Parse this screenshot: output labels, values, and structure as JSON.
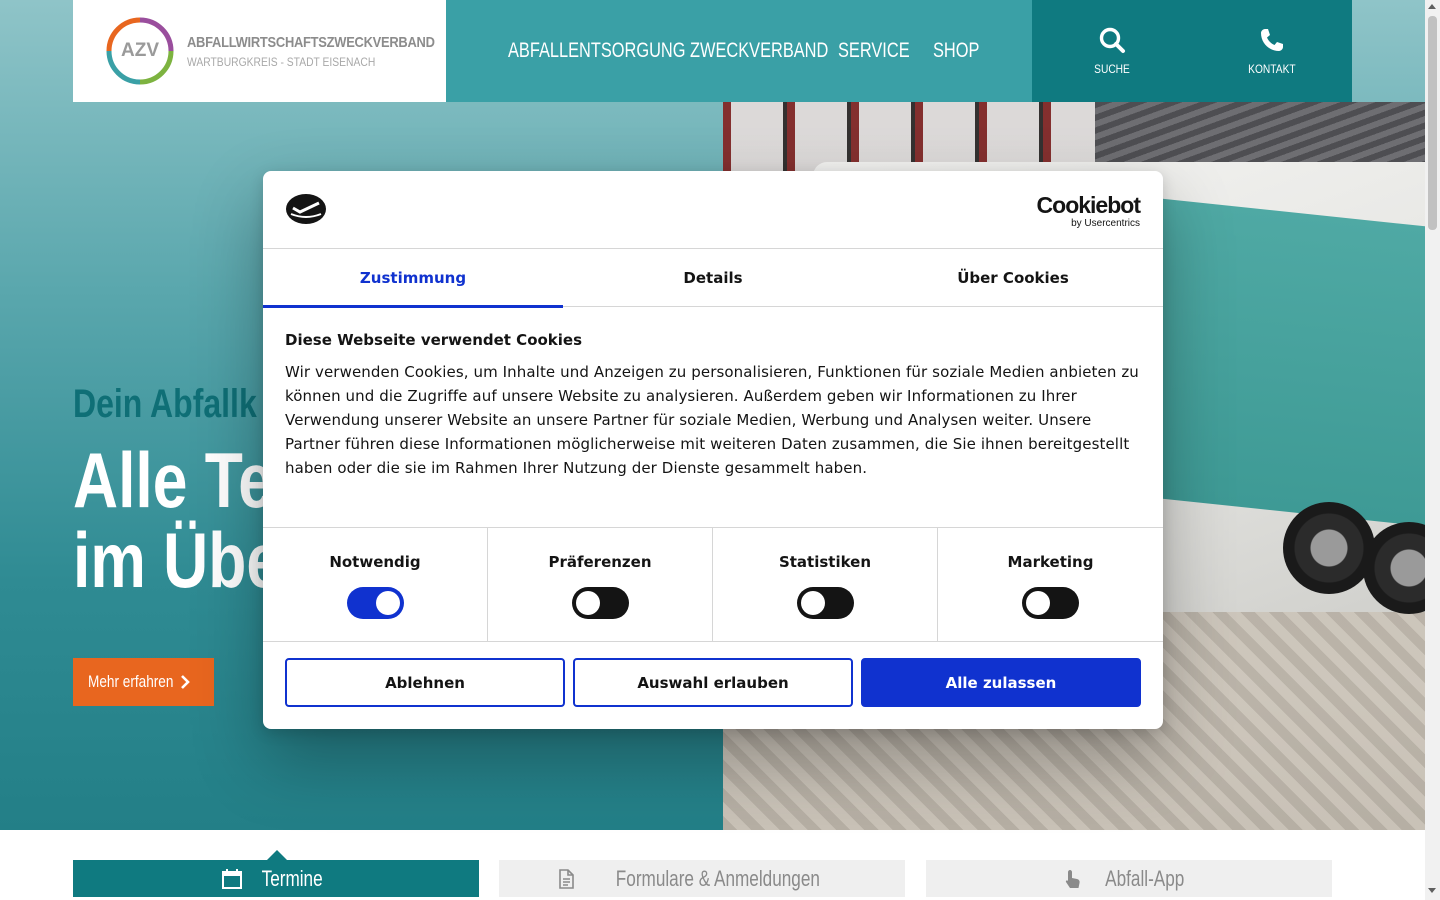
{
  "header": {
    "logo": {
      "mark_text": "AZV",
      "title": "ABFALLWIRTSCHAFTSZWECKVERBAND",
      "subtitle": "WARTBURGKREIS - STADT EISENACH",
      "ring_colors": [
        "#e8661f",
        "#3aa0a6",
        "#7db340",
        "#9a4e9d"
      ]
    },
    "nav": [
      {
        "label": "ABFALLENTSORGUNG"
      },
      {
        "label": "ZWECKVERBAND"
      },
      {
        "label": "SERVICE"
      },
      {
        "label": "SHOP"
      }
    ],
    "utility": [
      {
        "label": "SUCHE",
        "icon": "search-icon"
      },
      {
        "label": "KONTAKT",
        "icon": "phone-icon"
      }
    ]
  },
  "hero": {
    "kicker": "Dein Abfallk",
    "title_line1": "Alle Te",
    "title_line2": "im Übe",
    "button_label": "Mehr erfahren",
    "button_icon": "chevron-right-icon"
  },
  "bottom_tabs": [
    {
      "label": "Termine",
      "icon": "calendar-icon",
      "active": true
    },
    {
      "label": "Formulare & Anmeldungen",
      "icon": "document-icon",
      "active": false
    },
    {
      "label": "Abfall-App",
      "icon": "hand-pointer-icon",
      "active": false
    }
  ],
  "cookie_dialog": {
    "brand": "Cookiebot",
    "brand_sub": "by Usercentrics",
    "tabs": [
      {
        "label": "Zustimmung",
        "active": true
      },
      {
        "label": "Details",
        "active": false
      },
      {
        "label": "Über Cookies",
        "active": false
      }
    ],
    "title": "Diese Webseite verwendet Cookies",
    "text": "Wir verwenden Cookies, um Inhalte und Anzeigen zu personalisieren, Funktionen für soziale Medien anbieten zu können und die Zugriffe auf unsere Website zu analysieren. Außerdem geben wir Informationen zu Ihrer Verwendung unserer Website an unsere Partner für soziale Medien, Werbung und Analysen weiter. Unsere Partner führen diese Informationen möglicherweise mit weiteren Daten zusammen, die Sie ihnen bereitgestellt haben oder die sie im Rahmen Ihrer Nutzung der Dienste gesammelt haben.",
    "toggles": [
      {
        "label": "Notwendig",
        "on": true
      },
      {
        "label": "Präferenzen",
        "on": false
      },
      {
        "label": "Statistiken",
        "on": false
      },
      {
        "label": "Marketing",
        "on": false
      }
    ],
    "buttons": {
      "decline": "Ablehnen",
      "allow_selection": "Auswahl erlauben",
      "allow_all": "Alle zulassen"
    },
    "accent_color": "#1032cf"
  },
  "colors": {
    "teal_nav": "#3aa0a6",
    "teal_dark": "#0f7a80",
    "orange": "#e8661f"
  }
}
